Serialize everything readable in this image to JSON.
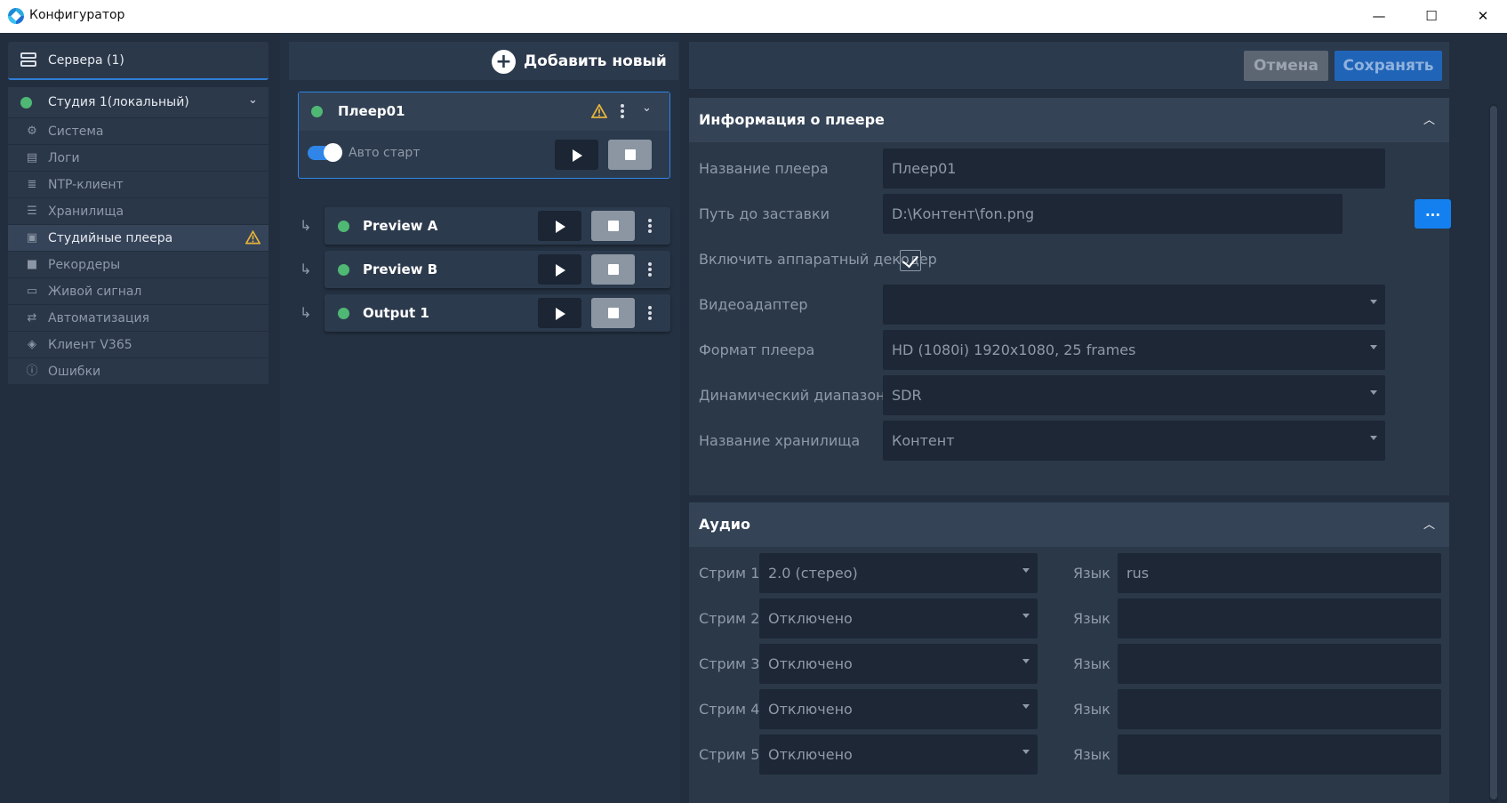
{
  "window": {
    "title": "Конфигуратор",
    "controls": {
      "minimize": "—",
      "maximize": "☐",
      "close": "✕"
    }
  },
  "sidebar": {
    "servers_label": "Сервера (1)",
    "studio": {
      "label": "Студия 1(локальный)",
      "status_color": "#4fb874"
    },
    "items": [
      {
        "label": "Система",
        "icon": "gear-icon",
        "glyph": "⚙",
        "active": false
      },
      {
        "label": "Логи",
        "icon": "log-icon",
        "glyph": "▤",
        "active": false
      },
      {
        "label": "NTP-клиент",
        "icon": "server-icon",
        "glyph": "≣",
        "active": false
      },
      {
        "label": "Хранилища",
        "icon": "storage-icon",
        "glyph": "☰",
        "active": false
      },
      {
        "label": "Студийные плеера",
        "icon": "player-icon",
        "glyph": "▣",
        "active": true,
        "warning": true
      },
      {
        "label": "Рекордеры",
        "icon": "camera-icon",
        "glyph": "■",
        "active": false
      },
      {
        "label": "Живой сигнал",
        "icon": "tv-icon",
        "glyph": "▭",
        "active": false
      },
      {
        "label": "Автоматизация",
        "icon": "automation-icon",
        "glyph": "⇄",
        "active": false
      },
      {
        "label": "Клиент V365",
        "icon": "cube-icon",
        "glyph": "◈",
        "active": false
      },
      {
        "label": "Ошибки",
        "icon": "error-icon",
        "glyph": "ⓘ",
        "active": false
      }
    ]
  },
  "players": {
    "add_label": "Добавить новый",
    "main": {
      "name": "Плеер01",
      "autostart_label": "Авто старт",
      "autostart_on": true,
      "warning": true
    },
    "outputs": [
      {
        "name": "Preview A",
        "arrow": "↳"
      },
      {
        "name": "Preview B",
        "arrow": "↳"
      },
      {
        "name": "Output 1",
        "arrow": "↳"
      }
    ]
  },
  "actions": {
    "cancel": "Отмена",
    "save": "Сохранять"
  },
  "info": {
    "title": "Информация о плеере",
    "fields": [
      {
        "label": "Название плеера",
        "value": "Плеер01",
        "type": "text"
      },
      {
        "label": "Путь до заставки",
        "value": "D:\\Контент\\fon.png",
        "type": "browse",
        "button": "..."
      },
      {
        "label": "Включить аппаратный декодер",
        "value": "",
        "type": "checkbox",
        "checked": true
      },
      {
        "label": "Видеоадаптер",
        "value": "",
        "type": "select"
      },
      {
        "label": "Формат плеера",
        "value": "HD (1080i) 1920x1080, 25 frames",
        "type": "select"
      },
      {
        "label": "Динамический диапазон",
        "value": "SDR",
        "type": "select"
      },
      {
        "label": "Название хранилища",
        "value": "Контент",
        "type": "select"
      }
    ]
  },
  "audio": {
    "title": "Аудио",
    "lang_label": "Язык",
    "streams": [
      {
        "label": "Стрим 1",
        "value": "2.0 (стерео)",
        "lang": "rus"
      },
      {
        "label": "Стрим 2",
        "value": "Отключено",
        "lang": ""
      },
      {
        "label": "Стрим 3",
        "value": "Отключено",
        "lang": ""
      },
      {
        "label": "Стрим 4",
        "value": "Отключено",
        "lang": ""
      },
      {
        "label": "Стрим 5",
        "value": "Отключено",
        "lang": ""
      }
    ]
  },
  "colors": {
    "accent": "#2f86e8",
    "status_ok": "#4fb874",
    "warning": "#e5b33a",
    "save": "#2064b8"
  }
}
